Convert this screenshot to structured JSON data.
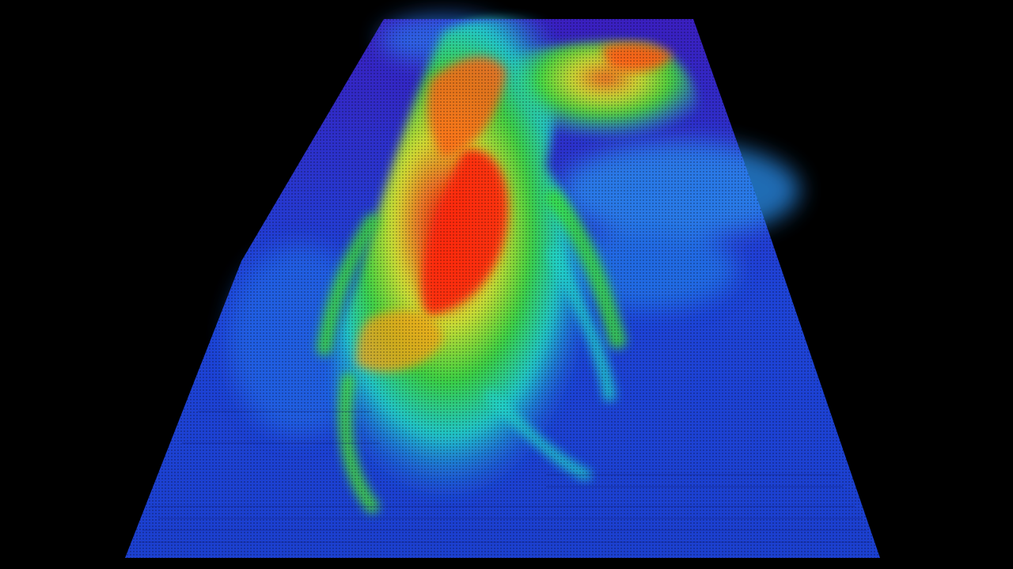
{
  "image": {
    "subject": "3d-terrain-point-cloud-render",
    "colormap": "height-rainbow",
    "colors": {
      "background": "#000000",
      "lowest": "#2a1fd0",
      "low": "#1f6fe0",
      "mid_low": "#22d4c8",
      "mid": "#3ee032",
      "mid_high": "#e6ef24",
      "high": "#ff8a10",
      "highest": "#ff1a0a"
    }
  }
}
